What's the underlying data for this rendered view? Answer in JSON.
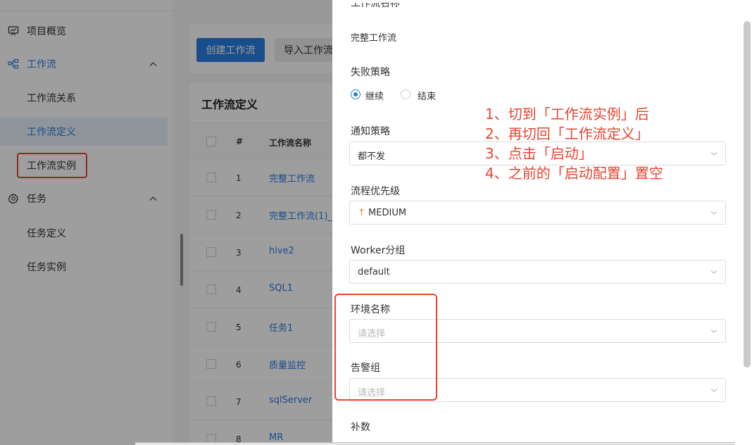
{
  "sidebar": {
    "items": [
      {
        "label": "项目概览",
        "icon": "monitor-icon"
      },
      {
        "label": "工作流",
        "icon": "workflow-icon",
        "caret": "^"
      },
      {
        "label": "工作流关系"
      },
      {
        "label": "工作流定义"
      },
      {
        "label": "工作流实例"
      },
      {
        "label": "任务",
        "icon": "gear-icon",
        "caret": "^"
      },
      {
        "label": "任务定义"
      },
      {
        "label": "任务实例"
      }
    ]
  },
  "toolbar": {
    "create_label": "创建工作流",
    "import_label": "导入工作流"
  },
  "table": {
    "title": "工作流定义",
    "headers": {
      "num": "#",
      "name": "工作流名称"
    },
    "rows": [
      {
        "num": "1",
        "name": "完整工作流"
      },
      {
        "num": "2",
        "name": "完整工作流(1)_"
      },
      {
        "num": "3",
        "name": "hive2"
      },
      {
        "num": "4",
        "name": "SQL1"
      },
      {
        "num": "5",
        "name": "任务1"
      },
      {
        "num": "6",
        "name": "质量监控"
      },
      {
        "num": "7",
        "name": "sqlServer"
      },
      {
        "num": "8",
        "name": "MR"
      }
    ]
  },
  "drawer": {
    "workflow_name_value": "完整工作流",
    "failure_strategy": {
      "label": "失败策略",
      "options": [
        "继续",
        "结束"
      ],
      "selected": "继续"
    },
    "notify_strategy": {
      "label": "通知策略",
      "value": "都不发"
    },
    "priority": {
      "label": "流程优先级",
      "value": "MEDIUM",
      "arrow": "↑",
      "arrow_color": "#f08c2b"
    },
    "worker_group": {
      "label": "Worker分组",
      "value": "default"
    },
    "environment": {
      "label": "环境名称",
      "placeholder": "请选择"
    },
    "alarm_group": {
      "label": "告警组",
      "placeholder": "请选择"
    },
    "complement": {
      "label": "补数"
    }
  },
  "annotation": {
    "lines": [
      "1、切到「工作流实例」后",
      "2、再切回「工作流定义」",
      "3、点击「启动」",
      "4、之前的「启动配置」置空"
    ],
    "color": "#e8432f"
  },
  "colors": {
    "accent": "#2a7de1",
    "highlight": "#e8432f"
  }
}
